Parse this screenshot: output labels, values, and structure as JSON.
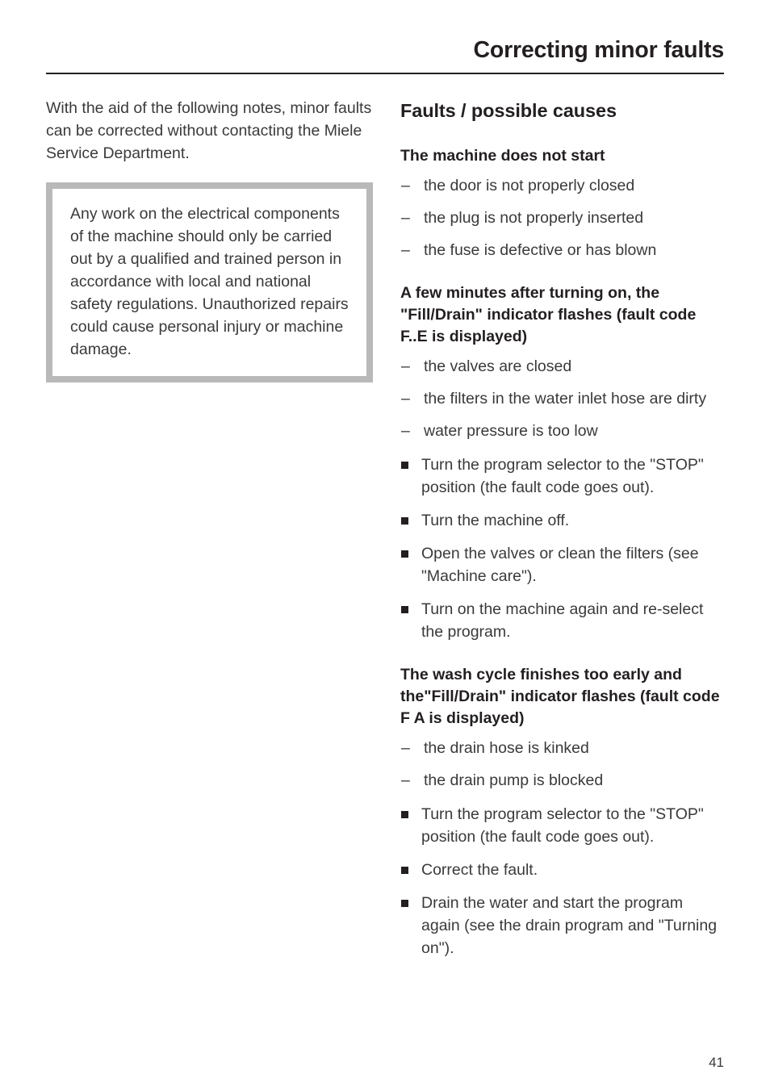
{
  "header": {
    "title": "Correcting minor faults"
  },
  "left_column": {
    "intro": "With the aid of the following notes, minor faults can be corrected without contacting the Miele Service Department.",
    "warning": {
      "text": "Any work on the electrical components of the machine should only be carried out by a qualified and trained person in accordance with local and national safety regulations. Unauthorized repairs could cause personal injury or machine damage."
    }
  },
  "right_column": {
    "section_title": "Faults / possible causes",
    "faults": [
      {
        "heading": "The machine does not start",
        "causes": [
          "the door is not properly closed",
          "the plug is not properly inserted",
          "the fuse is defective or has blown"
        ],
        "actions": []
      },
      {
        "heading": "A few minutes after turning on, the \"Fill/Drain\" indicator flashes (fault code F..E is displayed)",
        "causes": [
          "the valves are closed",
          "the filters in the water inlet hose are dirty",
          "water pressure is too low"
        ],
        "actions": [
          "Turn the program selector to the \"STOP\" position (the fault code goes out).",
          "Turn the machine off.",
          "Open the valves or clean the filters (see \"Machine care\").",
          "Turn on the machine again and re-select the program."
        ]
      },
      {
        "heading": "The wash cycle finishes too early and the\"Fill/Drain\" indicator flashes (fault code F A is displayed)",
        "causes": [
          "the drain hose is kinked",
          "the drain pump is blocked"
        ],
        "actions": [
          "Turn the program selector to the \"STOP\" position (the fault code goes out).",
          "Correct the fault.",
          "Drain the water and start the program again (see the drain program and \"Turning on\")."
        ]
      }
    ]
  },
  "footer": {
    "page_number": "41"
  },
  "bullets": {
    "dash": "–"
  },
  "colors": {
    "text": "#231f20",
    "body_text": "#3a3a3a",
    "rule": "#231f20",
    "warning_border": "#b9b9b9",
    "page_background": "#ffffff"
  }
}
